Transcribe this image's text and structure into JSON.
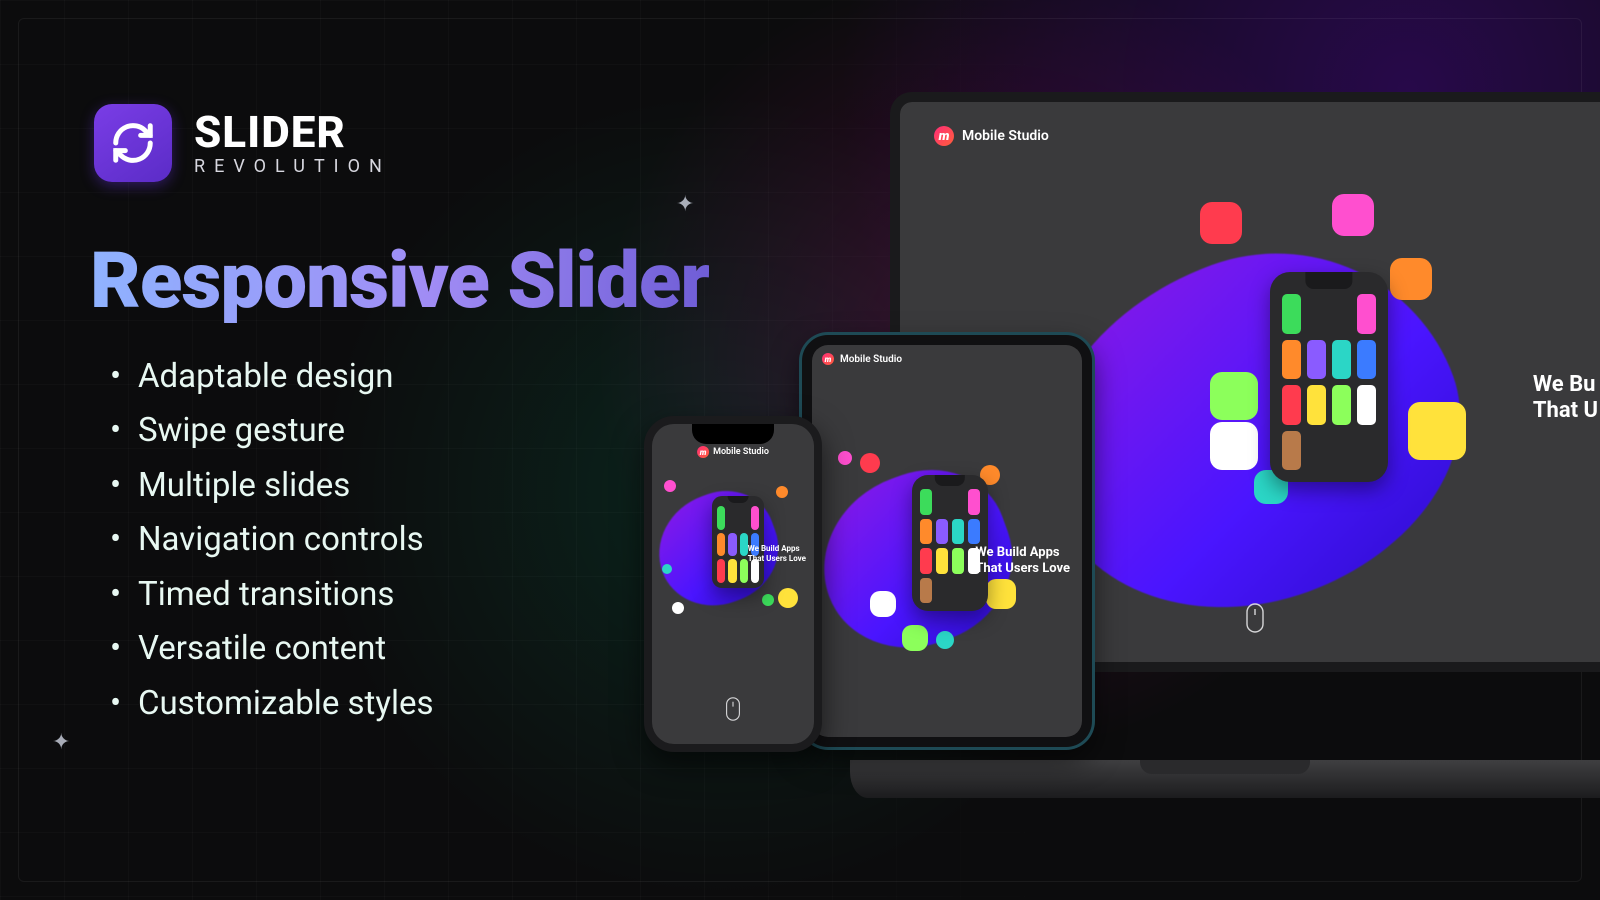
{
  "logo": {
    "line1": "SLIDER",
    "line2": "REVOLUTION"
  },
  "headline": "Responsive Slider",
  "features": [
    "Adaptable design",
    "Swipe gesture",
    "Multiple slides",
    "Navigation controls",
    "Timed transitions",
    "Versatile content",
    "Customizable styles"
  ],
  "device_content": {
    "brand": "Mobile Studio",
    "tagline_line1": "We Build Apps",
    "tagline_line2": "That Users Love",
    "tagline_line1_clipped": "We Bu",
    "tagline_line2_clipped": "That U"
  }
}
